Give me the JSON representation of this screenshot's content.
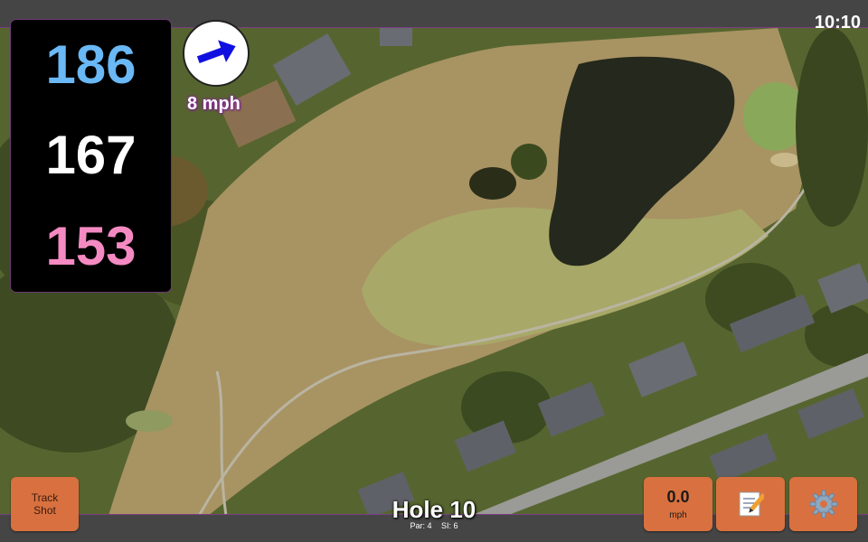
{
  "status_bar": {
    "time": "10:10"
  },
  "yardage": {
    "back": "186",
    "middle": "167",
    "front": "153"
  },
  "wind": {
    "speed_label": "8 mph",
    "arrow_color": "#1010e0"
  },
  "hole": {
    "title": "Hole 10",
    "par_label": "Par: 4",
    "si_label": "SI: 6"
  },
  "buttons": {
    "track_shot_line1": "Track",
    "track_shot_line2": "Shot",
    "speed_value": "0.0",
    "speed_unit": "mph",
    "notes_icon": "memo-icon",
    "settings_icon": "gear-icon"
  },
  "colors": {
    "button_bg": "#d8713f",
    "yardage_back": "#6ab8f5",
    "yardage_middle": "#ffffff",
    "yardage_front": "#f58ac2",
    "accent_border": "#7a3e82"
  }
}
